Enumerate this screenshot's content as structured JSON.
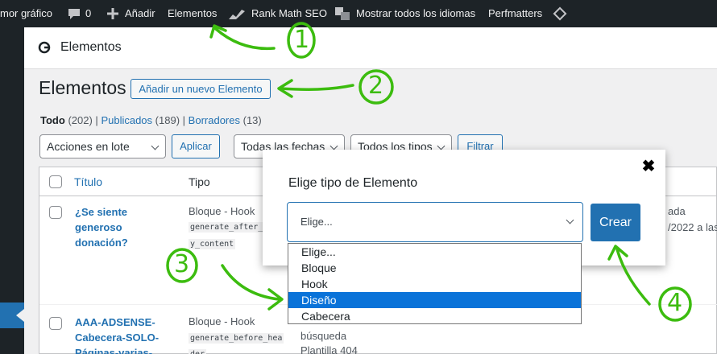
{
  "adminbar": {
    "site_partial": "mor gráfico",
    "comments_count": "0",
    "add_new": "Añadir",
    "elements": "Elementos",
    "rank_math": "Rank Math SEO",
    "languages": "Mostrar todos los idiomas",
    "perfmatters": "Perfmatters"
  },
  "plugin_header": {
    "title": "Elementos"
  },
  "page": {
    "title": "Elementos",
    "add_new_button": "Añadir un nuevo Elemento"
  },
  "views": {
    "all_label": "Todo",
    "all_count": "(202)",
    "published_label": "Publicados",
    "published_count": "(189)",
    "drafts_label": "Borradores",
    "drafts_count": "(13)",
    "sep": "|"
  },
  "filters": {
    "bulk_actions": "Acciones en lote",
    "apply": "Aplicar",
    "all_dates": "Todas las fechas",
    "all_types": "Todos los tipos",
    "filter": "Filtrar"
  },
  "table": {
    "columns": {
      "title": "Título",
      "type": "Tipo"
    },
    "rows": [
      {
        "title_lines": [
          "¿Se siente",
          "generoso",
          "donación?"
        ],
        "type": "Bloque - Hook",
        "code": [
          "generate_after_",
          "y_content"
        ],
        "right_lines": [
          "ada",
          "/2022 a las"
        ]
      },
      {
        "title_lines": [
          "AAA-ADSENSE-",
          "Cabecera-SOLO-",
          "Páginas-varias-"
        ],
        "type": "Bloque - Hook",
        "code": [
          "generate_before_hea",
          "der"
        ],
        "extra_lines": [
          "búsqueda",
          "Plantilla 404"
        ]
      }
    ]
  },
  "modal": {
    "title": "Elige tipo de Elemento",
    "close": "✖",
    "select_value": "Elige...",
    "create_button": "Crear",
    "options": [
      "Elige...",
      "Bloque",
      "Hook",
      "Diseño",
      "Cabecera"
    ],
    "selected_option": "Diseño"
  },
  "annotations": [
    "1",
    "2",
    "3",
    "4"
  ],
  "colors": {
    "adminbar": "#1d2327",
    "accent": "#2271b1",
    "annotation": "#3cbc0f",
    "dropdown_highlight": "#0a73d9"
  }
}
